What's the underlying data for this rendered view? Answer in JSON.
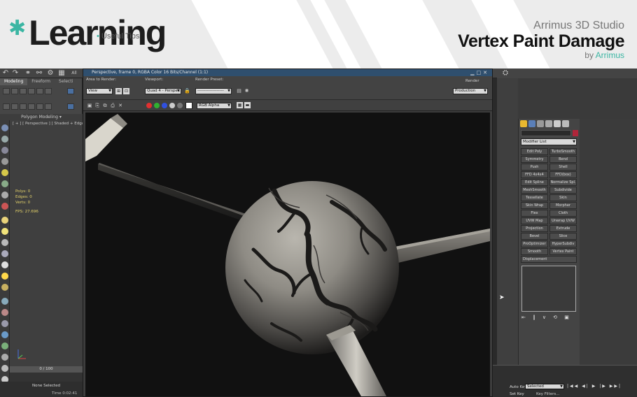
{
  "banner": {
    "logo_star": "✱",
    "logo_word": "Learning",
    "logo_sub": "Useful Tips",
    "app_name": "Arrimus 3D Studio",
    "video_title": "Vertex Paint Damage",
    "by_prefix": "by",
    "by_brand": "Arrimus"
  },
  "ribbon": {
    "tabs": [
      "Modeling",
      "Freeform",
      "Selecti"
    ],
    "footer": "Polygon Modeling ▾"
  },
  "topbar": {
    "all_label": "All"
  },
  "left_viewport": {
    "label": "[ + ] [ Perspective ] [ Shaded + Edged Faces ]",
    "stats": [
      "Polys:   0",
      "Edges:   0",
      "Verts:   0"
    ],
    "fps": "FPS:       27.696"
  },
  "timeline": {
    "frame": "0 / 100",
    "status_selected": "None Selected",
    "status_time": "Time  0:02:41"
  },
  "render_window": {
    "title": "Perspective, frame 0, RGBA Color 16 Bits/Channel (1:1)",
    "area_label": "Area to Render:",
    "area_value": "View",
    "viewport_label": "Viewport:",
    "viewport_value": "Quad 4 - Perspec",
    "preset_label": "Render Preset:",
    "preset_value": "-------------------",
    "render_label": "Render",
    "render_value": "Production",
    "channel_value": "RGB Alpha"
  },
  "command_panel": {
    "modifier_list": "Modifier List",
    "modifiers": [
      "Edit Poly",
      "TurboSmooth",
      "Symmetry",
      "Bend",
      "Push",
      "Shell",
      "FFD 4x4x4",
      "FFD(box)",
      "Edit Spline",
      "Normalize Spl.",
      "MeshSmooth",
      "Subdivide",
      "Tessellate",
      "Skin",
      "Skin Wrap",
      "Morpher",
      "Flex",
      "Cloth",
      "UVW Map",
      "Unwrap UVW",
      "Projection",
      "Extrude",
      "Bevel",
      "Slice",
      "ProOptimizer",
      "HyperSubdiv",
      "Smooth",
      "Vertex Paint"
    ],
    "modifier_last": "Displacement",
    "stack_icons": "⇤ ‖ ∨ ⟲ ▣"
  },
  "bottom_controls": {
    "auto_key": "Auto Key",
    "set_key": "Set Key",
    "selected": "Selected",
    "key_filters": "Key Filters...",
    "play_controls": "|◀◀ ◀| ▶ |▶ ▶▶|"
  },
  "colors": {
    "accent": "#3bb6a3",
    "title_bar": "#2f4f6e",
    "name_color": "#b0263a"
  }
}
